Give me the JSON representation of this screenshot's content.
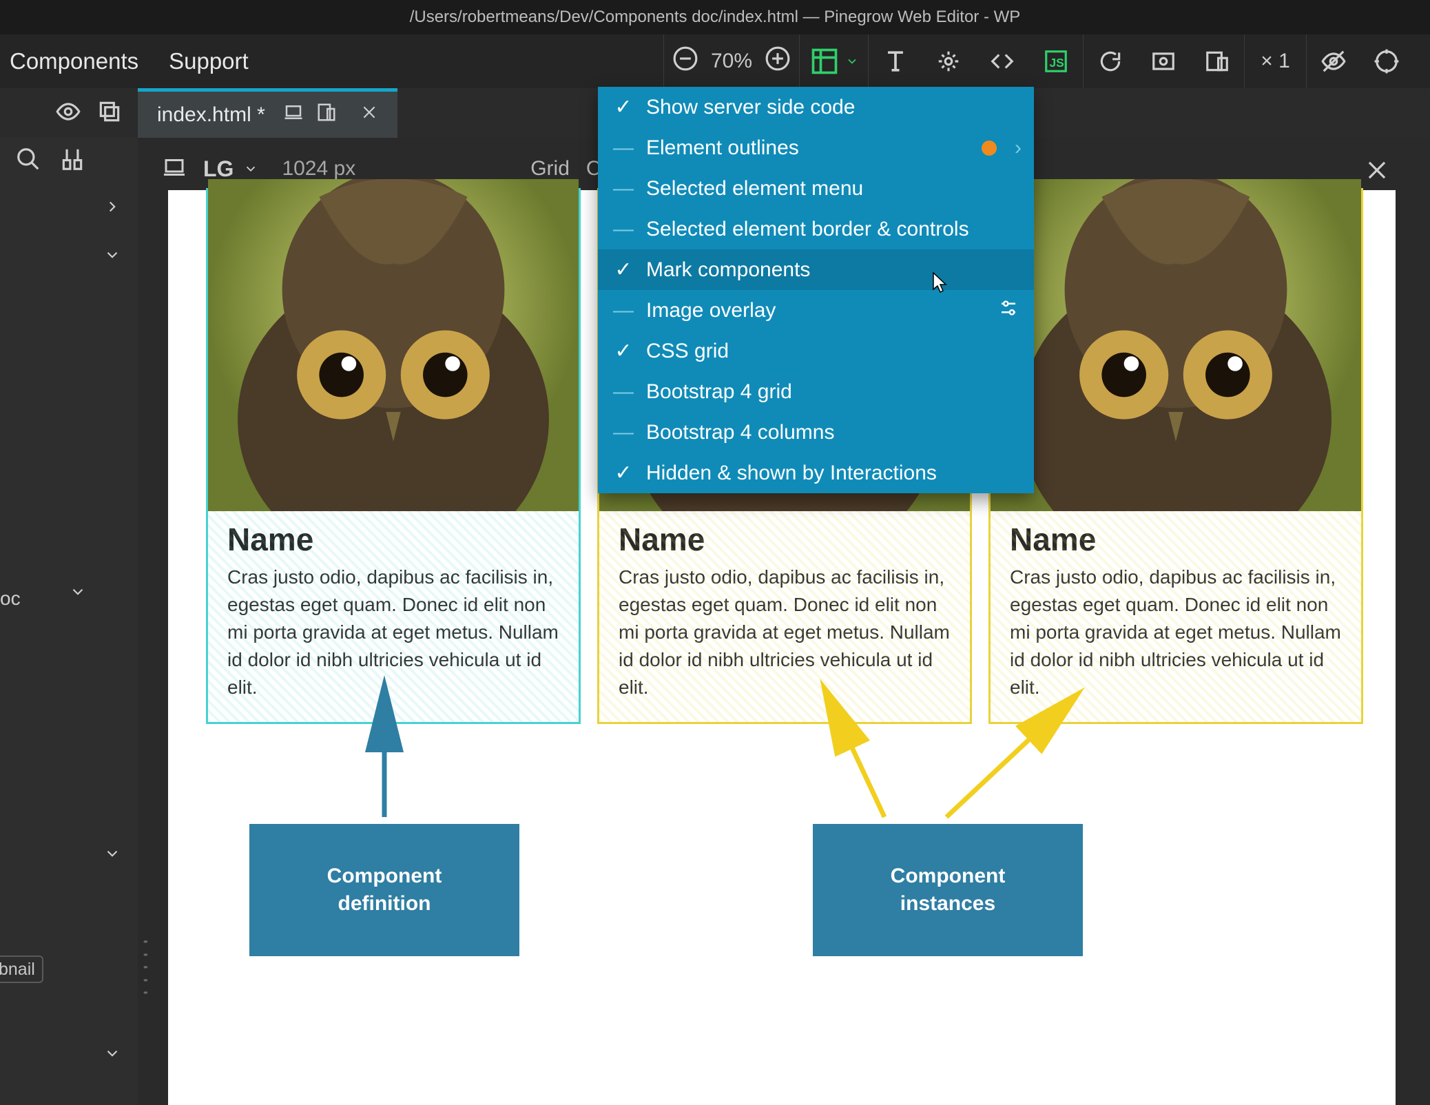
{
  "titlebar": "/Users/robertmeans/Dev/Components doc/index.html — Pinegrow Web Editor - WP",
  "menubar": {
    "items": [
      "Components",
      "Support"
    ],
    "zoom": "70%",
    "multiplier": "× 1"
  },
  "tab": {
    "title": "index.html *"
  },
  "subbar": {
    "breakpoint": "LG",
    "width": "1024 px",
    "grid": "Grid",
    "col": "Col"
  },
  "leftpanel": {
    "oc": "oc",
    "bnail": "bnail"
  },
  "dropdown": {
    "items": [
      {
        "label": "Show server side code",
        "state": "check"
      },
      {
        "label": "Element outlines",
        "state": "dash",
        "orange": true,
        "chevron": true
      },
      {
        "label": "Selected element menu",
        "state": "dash"
      },
      {
        "label": "Selected element border & controls",
        "state": "dash"
      },
      {
        "label": "Mark components",
        "state": "check",
        "hover": true
      },
      {
        "label": "Image overlay",
        "state": "dash",
        "sliders": true
      },
      {
        "label": "CSS grid",
        "state": "check"
      },
      {
        "label": "Bootstrap 4 grid",
        "state": "dash"
      },
      {
        "label": "Bootstrap 4 columns",
        "state": "dash"
      },
      {
        "label": "Hidden & shown by Interactions",
        "state": "check"
      }
    ]
  },
  "cards": [
    {
      "title": "Name",
      "body": "Cras justo odio, dapibus ac facilisis in, egestas eget quam. Donec id elit non mi porta gravida at eget metus. Nullam id dolor id nibh ultricies vehicula ut id elit."
    },
    {
      "title": "Name",
      "body": "Cras justo odio, dapibus ac facilisis in, egestas eget quam. Donec id elit non mi porta gravida at eget metus. Nullam id dolor id nibh ultricies vehicula ut id elit."
    },
    {
      "title": "Name",
      "body": "Cras justo odio, dapibus ac facilisis in, egestas eget quam. Donec id elit non mi porta gravida at eget metus. Nullam id dolor id nibh ultricies vehicula ut id elit."
    }
  ],
  "annotations": {
    "definition": "Component\ndefinition",
    "instances": "Component\ninstances"
  }
}
